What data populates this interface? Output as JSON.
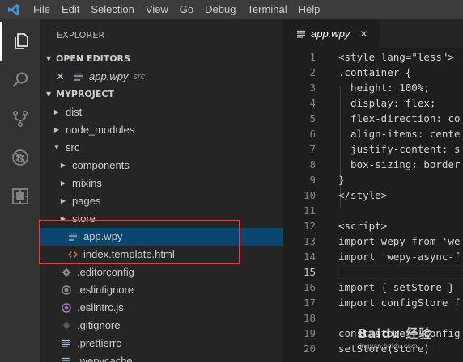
{
  "menu": {
    "items": [
      "File",
      "Edit",
      "Selection",
      "View",
      "Go",
      "Debug",
      "Terminal",
      "Help"
    ]
  },
  "activity_bar": {
    "icons": [
      "explorer-icon",
      "search-icon",
      "source-control-icon",
      "debug-icon",
      "extensions-icon"
    ]
  },
  "sidebar": {
    "title": "EXPLORER",
    "open_editors": {
      "header": "OPEN EDITORS",
      "items": [
        {
          "name": "app.wpy",
          "dir": "src"
        }
      ]
    },
    "project": {
      "header": "MYPROJECT",
      "rows": [
        {
          "name": "dist",
          "kind": "folder",
          "expanded": false,
          "depth": 0
        },
        {
          "name": "node_modules",
          "kind": "folder",
          "expanded": false,
          "depth": 0
        },
        {
          "name": "src",
          "kind": "folder",
          "expanded": true,
          "depth": 0
        },
        {
          "name": "components",
          "kind": "folder",
          "expanded": false,
          "depth": 1
        },
        {
          "name": "mixins",
          "kind": "folder",
          "expanded": false,
          "depth": 1
        },
        {
          "name": "pages",
          "kind": "folder",
          "expanded": false,
          "depth": 1
        },
        {
          "name": "store",
          "kind": "folder",
          "expanded": false,
          "depth": 1
        },
        {
          "name": "app.wpy",
          "kind": "file-lines",
          "depth": 1,
          "selected": true
        },
        {
          "name": "index.template.html",
          "kind": "file-html",
          "depth": 1
        },
        {
          "name": ".editorconfig",
          "kind": "file-gear",
          "depth": 0
        },
        {
          "name": ".eslintignore",
          "kind": "file-circle",
          "depth": 0
        },
        {
          "name": ".eslintrc.js",
          "kind": "file-eslint",
          "depth": 0
        },
        {
          "name": ".gitignore",
          "kind": "file-git",
          "depth": 0
        },
        {
          "name": ".prettierrc",
          "kind": "file-lines",
          "depth": 0
        },
        {
          "name": ".wepycache",
          "kind": "file-lines",
          "depth": 0
        }
      ]
    }
  },
  "editor": {
    "tab": {
      "label": "app.wpy"
    },
    "current_line": 15,
    "lines": [
      {
        "n": "1",
        "text": "<style lang=\"less\">"
      },
      {
        "n": "2",
        "text": ".container {"
      },
      {
        "n": "3",
        "text": "  height: 100%;"
      },
      {
        "n": "4",
        "text": "  display: flex;"
      },
      {
        "n": "5",
        "text": "  flex-direction: co"
      },
      {
        "n": "6",
        "text": "  align-items: cente"
      },
      {
        "n": "7",
        "text": "  justify-content: s"
      },
      {
        "n": "8",
        "text": "  box-sizing: border"
      },
      {
        "n": "9",
        "text": "}"
      },
      {
        "n": "10",
        "text": "</style>"
      },
      {
        "n": "11",
        "text": ""
      },
      {
        "n": "12",
        "text": "<script>"
      },
      {
        "n": "13",
        "text": "import wepy from 'we"
      },
      {
        "n": "14",
        "text": "import 'wepy-async-f"
      },
      {
        "n": "15",
        "text": ""
      },
      {
        "n": "16",
        "text": "import { setStore }"
      },
      {
        "n": "17",
        "text": "import configStore f"
      },
      {
        "n": "18",
        "text": ""
      },
      {
        "n": "19",
        "text": "const store = config"
      },
      {
        "n": "20",
        "text": "setStore(store)"
      }
    ]
  },
  "watermark": {
    "main": "Baidu 经验",
    "sub": "jingyan.baidu.com"
  },
  "colors": {
    "accent": "#094771",
    "highlight_box": "#e04343",
    "folder_chevron": "#c5c5c5",
    "html_icon": "#e37933",
    "file_lines_icon": "#a9c2d8"
  }
}
